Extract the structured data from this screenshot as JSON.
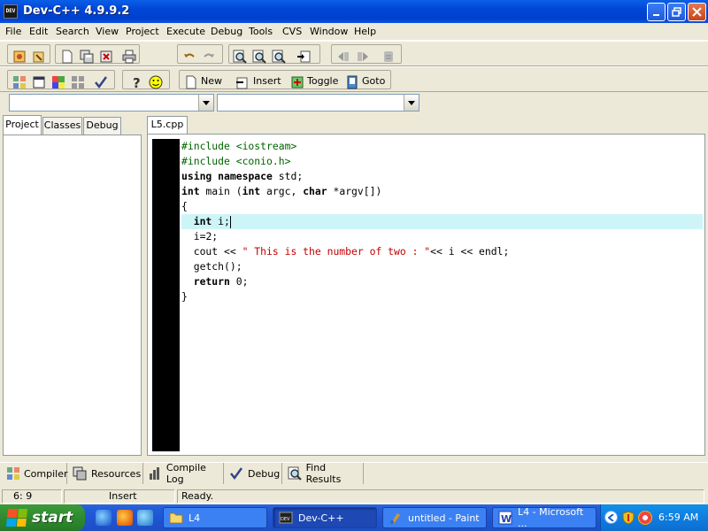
{
  "window": {
    "title": "Dev-C++ 4.9.9.2",
    "icon_label": "DEV"
  },
  "menu": [
    "File",
    "Edit",
    "Search",
    "View",
    "Project",
    "Execute",
    "Debug",
    "Tools",
    "CVS",
    "Window",
    "Help"
  ],
  "toolbar2": {
    "new_label": "New",
    "insert_label": "Insert",
    "toggle_label": "Toggle",
    "goto_label": "Goto"
  },
  "combos": {
    "class_value": "",
    "member_value": ""
  },
  "left_tabs": [
    "Project",
    "Classes",
    "Debug"
  ],
  "editor": {
    "file_tab": "L5.cpp",
    "lines": [
      "#include <iostream>",
      "#include <conio.h>",
      "using namespace std;",
      "int main (int argc, char *argv[])",
      "{",
      "  int i;",
      "  i=2;",
      "  cout << \" This is the number of two : \"<< i << endl;",
      "  getch();",
      "  return 0;",
      "}"
    ],
    "current_line": 6
  },
  "bottom_tabs": [
    "Compiler",
    "Resources",
    "Compile Log",
    "Debug",
    "Find Results"
  ],
  "status": {
    "position": "6: 9",
    "mode": "Insert",
    "message": "Ready."
  },
  "taskbar": {
    "start_label": "start",
    "tasks": [
      "L4",
      "Dev-C++",
      "untitled - Paint",
      "L4 - Microsoft ..."
    ],
    "active_task": "Dev-C++",
    "clock": "6:59 AM"
  },
  "colors": {
    "titlebar": "#0a5fe6",
    "current_line": "#cdf5f8",
    "string": "#c00000",
    "preprocessor": "#006400",
    "gutter": "#000000"
  }
}
